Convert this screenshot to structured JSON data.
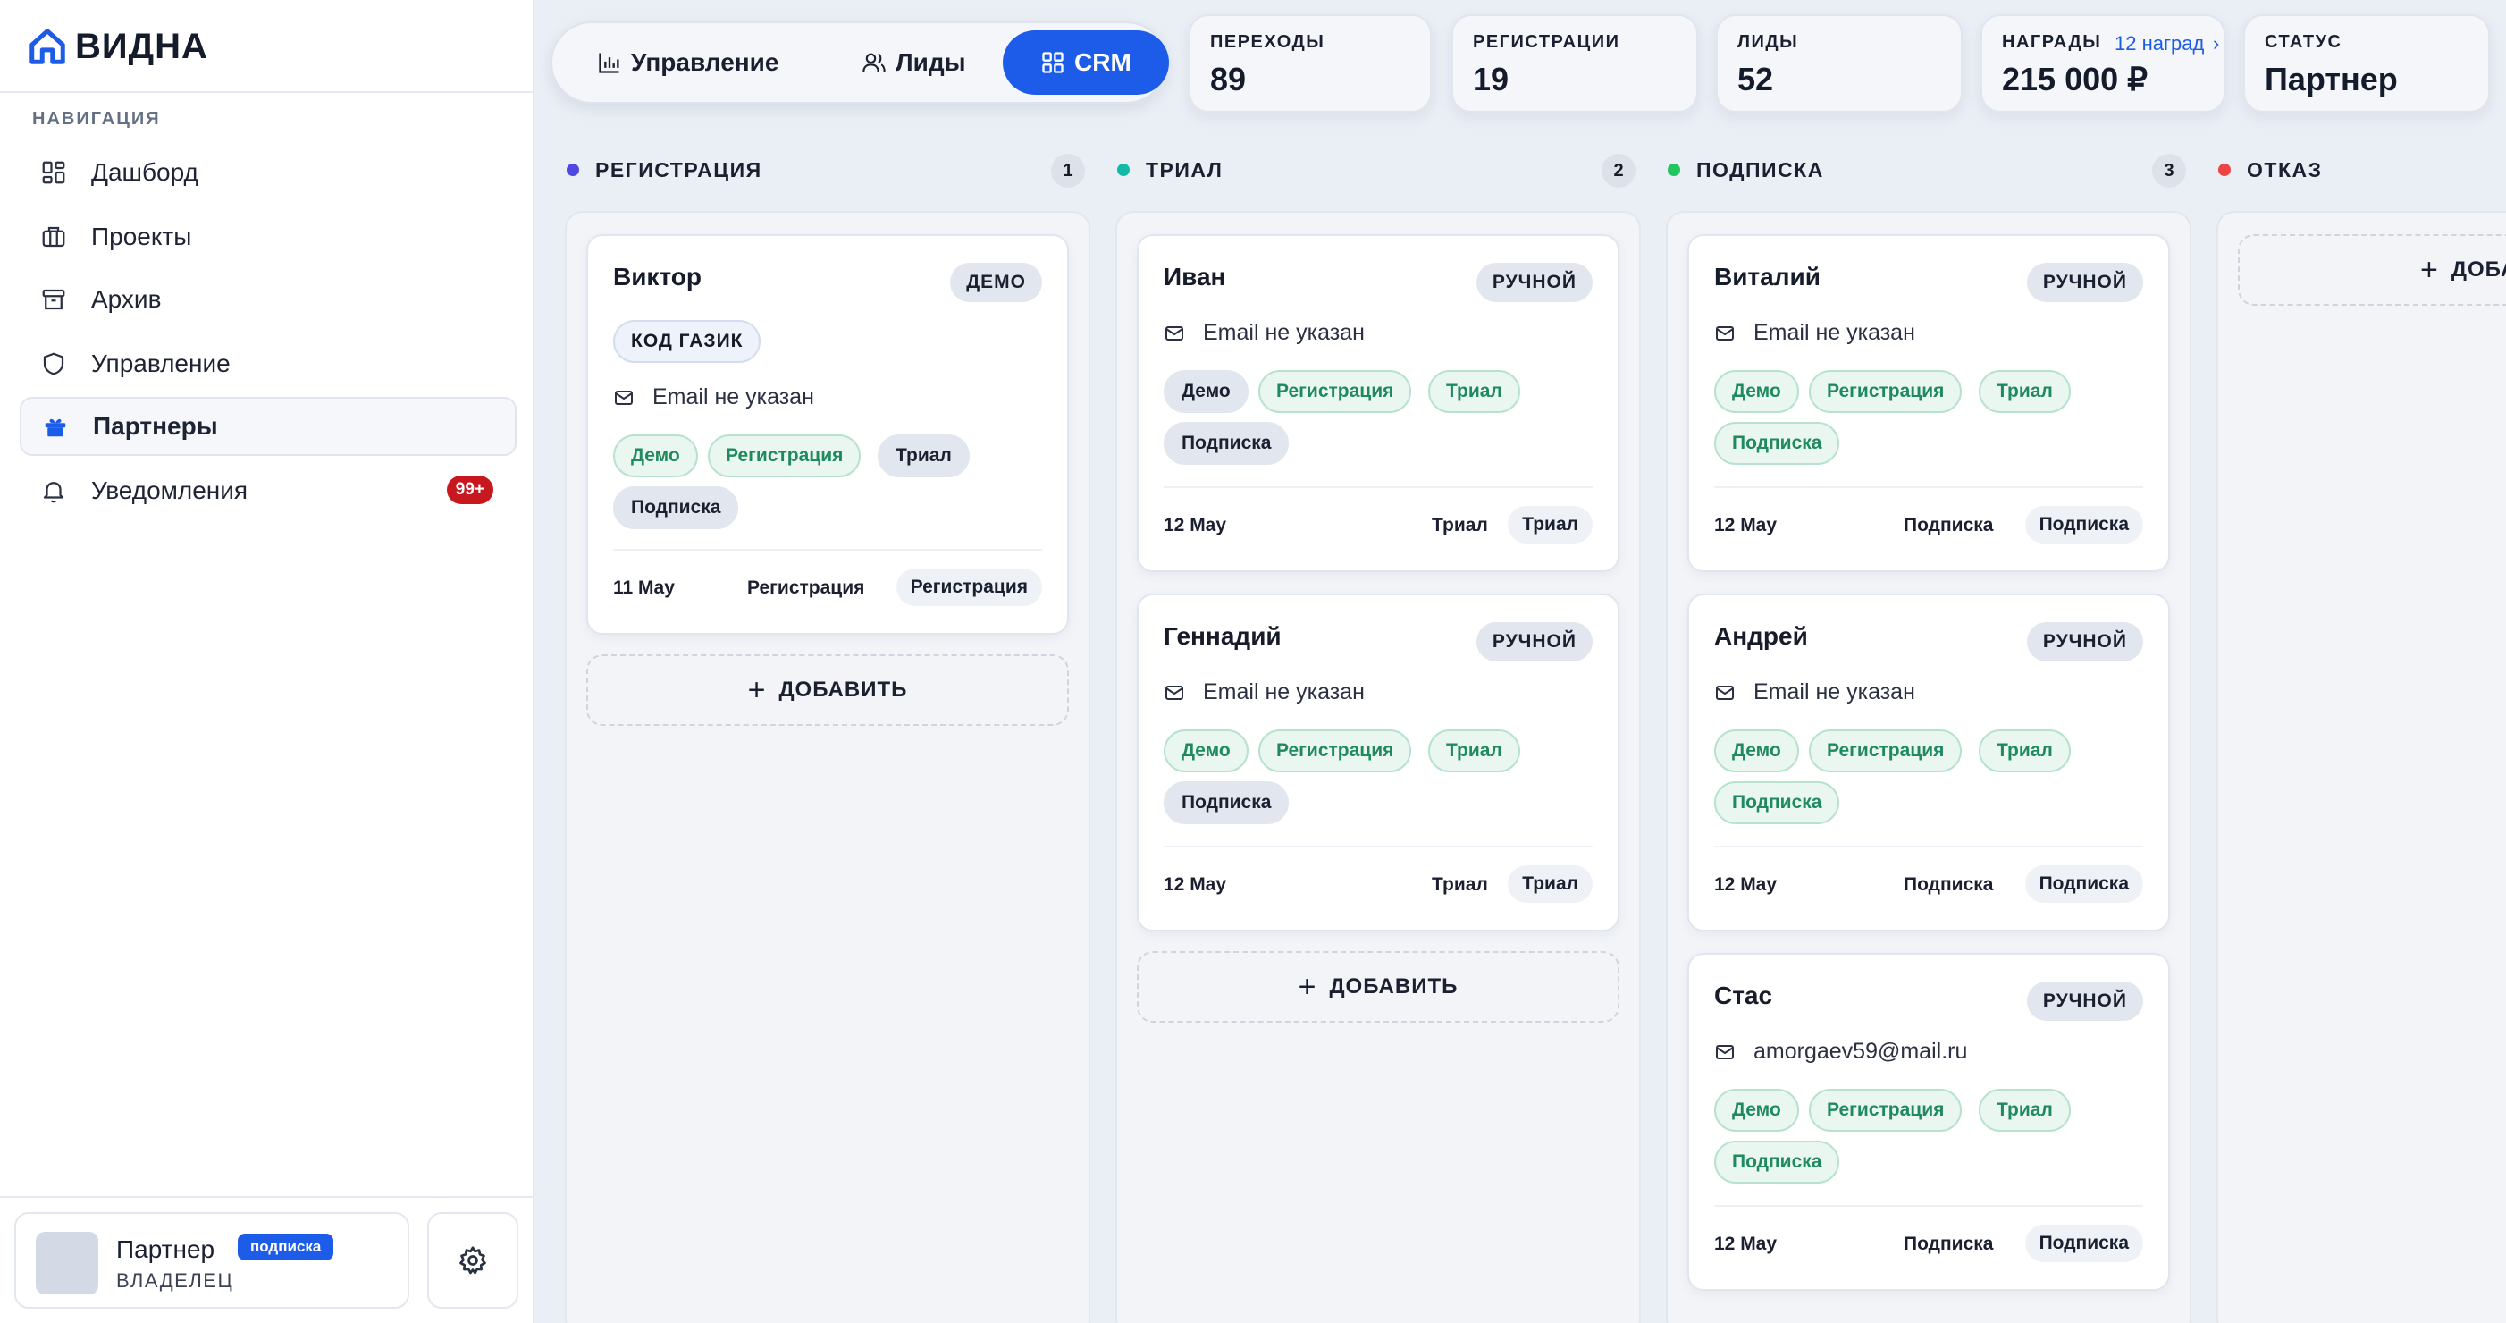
{
  "brand": {
    "name": "ВИДНА"
  },
  "sidebar": {
    "section_title": "НАВИГАЦИЯ",
    "items": [
      {
        "label": "Дашборд",
        "icon": "grid-icon"
      },
      {
        "label": "Проекты",
        "icon": "briefcase-icon"
      },
      {
        "label": "Архив",
        "icon": "archive-icon"
      },
      {
        "label": "Управление",
        "icon": "shield-icon"
      },
      {
        "label": "Партнеры",
        "icon": "gift-icon",
        "active": true
      },
      {
        "label": "Уведомления",
        "icon": "bell-icon",
        "badge": "99+"
      }
    ],
    "user": {
      "name": "Партнер",
      "tag": "подписка",
      "role": "ВЛАДЕЛЕЦ"
    }
  },
  "tabs": [
    {
      "label": "Управление",
      "icon": "bar-chart-icon"
    },
    {
      "label": "Лиды",
      "icon": "users-icon"
    },
    {
      "label": "CRM",
      "icon": "grid-icon",
      "active": true
    }
  ],
  "stats": {
    "transitions": {
      "label": "ПЕРЕХОДЫ",
      "value": "89"
    },
    "registrations": {
      "label": "РЕГИСТРАЦИИ",
      "value": "19"
    },
    "leads": {
      "label": "ЛИДЫ",
      "value": "52"
    },
    "rewards": {
      "label": "НАГРАДЫ",
      "value": "215 000 ₽",
      "extra": "12 наград"
    },
    "status": {
      "label": "СТАТУС",
      "value": "Партнер"
    }
  },
  "common": {
    "add_label": "ДОБАВИТЬ",
    "add_label_cut": "ДОБА"
  },
  "colors": {
    "accent": "#1c5ce8",
    "registration": "#4f46e5",
    "trial": "#14b8a6",
    "subscription": "#22c55e",
    "refusal": "#ef4444",
    "badge": "#c8181f"
  },
  "columns": [
    {
      "title": "РЕГИСТРАЦИЯ",
      "count": "1",
      "cards": [
        {
          "name": "Виктор",
          "type": "ДЕМО",
          "code": "КОД ГАЗИК",
          "email": "Email не указан",
          "tags": [
            "Демо",
            "Регистрация",
            "Триал",
            "Подписка"
          ],
          "date": "11 May",
          "stage": "Регистрация",
          "stage_chip": "Регистрация"
        }
      ]
    },
    {
      "title": "ТРИАЛ",
      "count": "2",
      "cards": [
        {
          "name": "Иван",
          "type": "РУЧНОЙ",
          "email": "Email не указан",
          "tags": [
            "Демо",
            "Регистрация",
            "Триал",
            "Подписка"
          ],
          "date": "12 May",
          "stage": "Триал",
          "stage_chip": "Триал"
        },
        {
          "name": "Геннадий",
          "type": "РУЧНОЙ",
          "email": "Email не указан",
          "tags": [
            "Демо",
            "Регистрация",
            "Триал",
            "Подписка"
          ],
          "date": "12 May",
          "stage": "Триал",
          "stage_chip": "Триал"
        }
      ]
    },
    {
      "title": "ПОДПИСКА",
      "count": "3",
      "cards": [
        {
          "name": "Виталий",
          "type": "РУЧНОЙ",
          "email": "Email не указан",
          "tags": [
            "Демо",
            "Регистрация",
            "Триал",
            "Подписка"
          ],
          "date": "12 May",
          "stage": "Подписка",
          "stage_chip": "Подписка"
        },
        {
          "name": "Андрей",
          "type": "РУЧНОЙ",
          "email": "Email не указан",
          "tags": [
            "Демо",
            "Регистрация",
            "Триал",
            "Подписка"
          ],
          "date": "12 May",
          "stage": "Подписка",
          "stage_chip": "Подписка"
        },
        {
          "name": "Стас",
          "type": "РУЧНОЙ",
          "email": "amorgaev59@mail.ru",
          "tags": [
            "Демо",
            "Регистрация",
            "Триал",
            "Подписка"
          ],
          "date": "12 May",
          "stage": "Подписка",
          "stage_chip": "Подписка"
        }
      ]
    },
    {
      "title": "ОТКАЗ"
    }
  ]
}
